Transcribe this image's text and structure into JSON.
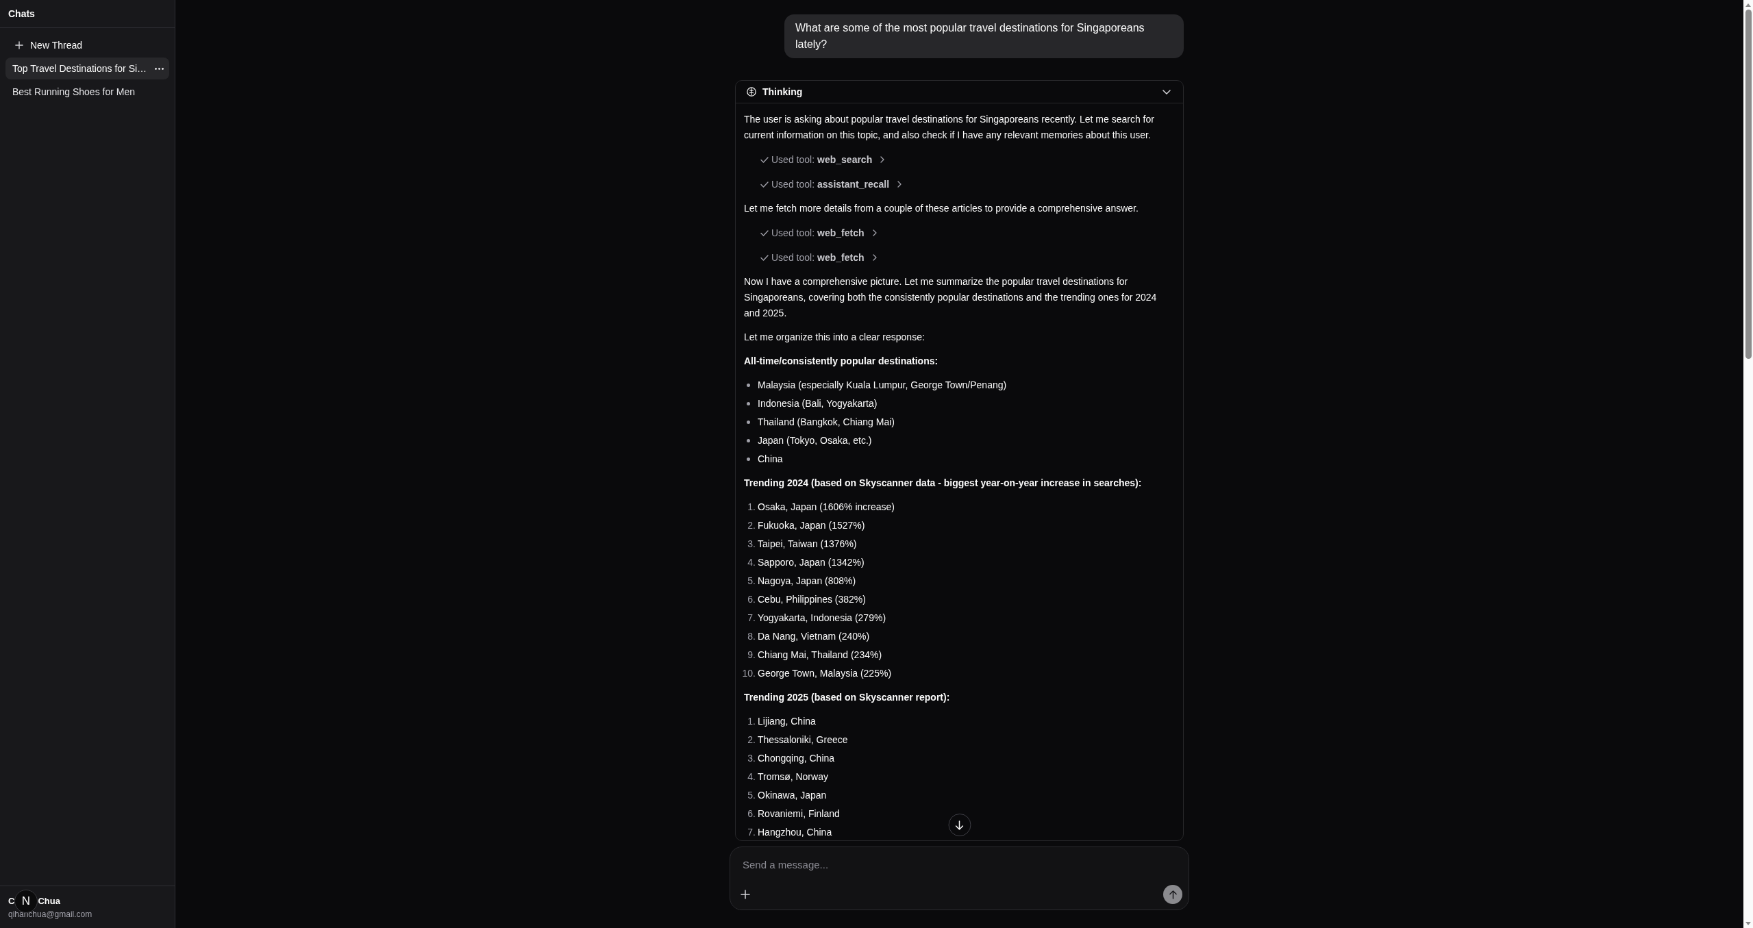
{
  "sidebar": {
    "title": "Chats",
    "new_thread": "New Thread",
    "threads": [
      {
        "title": "Top Travel Destinations for Si…",
        "selected": true
      },
      {
        "title": "Best Running Shoes for Men",
        "selected": false
      }
    ],
    "user": {
      "name_parts": [
        "C",
        "Chua"
      ],
      "email": "qihanchua@gmail.com"
    }
  },
  "floating_badge": {
    "letter": "N"
  },
  "conversation": {
    "user_message": "What are some of the most popular travel destinations for Singaporeans lately?",
    "thinking": {
      "title": "Thinking",
      "expanded": true,
      "blocks": [
        {
          "kind": "paragraph",
          "text": "The user is asking about popular travel destinations for Singaporeans recently. Let me search for current information on this topic, and also check if I have any relevant memories about this user."
        },
        {
          "kind": "tool",
          "label": "Used tool:",
          "name": "web_search",
          "done": true
        },
        {
          "kind": "tool",
          "label": "Used tool:",
          "name": "assistant_recall",
          "done": true
        },
        {
          "kind": "paragraph",
          "text": "Let me fetch more details from a couple of these articles to provide a comprehensive answer."
        },
        {
          "kind": "tool",
          "label": "Used tool:",
          "name": "web_fetch",
          "done": true
        },
        {
          "kind": "tool",
          "label": "Used tool:",
          "name": "web_fetch",
          "done": true
        },
        {
          "kind": "paragraph",
          "text": "Now I have a comprehensive picture. Let me summarize the popular travel destinations for Singaporeans, covering both the consistently popular destinations and the trending ones for 2024 and 2025."
        },
        {
          "kind": "paragraph",
          "text": "Let me organize this into a clear response:"
        },
        {
          "kind": "heading",
          "text": "All-time/consistently popular destinations:"
        },
        {
          "kind": "bullets",
          "items": [
            "Malaysia (especially Kuala Lumpur, George Town/Penang)",
            "Indonesia (Bali, Yogyakarta)",
            "Thailand (Bangkok, Chiang Mai)",
            "Japan (Tokyo, Osaka, etc.)",
            "China"
          ]
        },
        {
          "kind": "heading",
          "text": "Trending 2024 (based on Skyscanner data - biggest year-on-year increase in searches):"
        },
        {
          "kind": "numbered",
          "items": [
            {
              "number": "1.",
              "text": "Osaka, Japan (1606% increase)"
            },
            {
              "number": "2.",
              "text": "Fukuoka, Japan (1527%)"
            },
            {
              "number": "3.",
              "text": "Taipei, Taiwan (1376%)"
            },
            {
              "number": "4.",
              "text": "Sapporo, Japan (1342%)"
            },
            {
              "number": "5.",
              "text": "Nagoya, Japan (808%)"
            },
            {
              "number": "6.",
              "text": "Cebu, Philippines (382%)"
            },
            {
              "number": "7.",
              "text": "Yogyakarta, Indonesia (279%)"
            },
            {
              "number": "8.",
              "text": "Da Nang, Vietnam (240%)"
            },
            {
              "number": "9.",
              "text": "Chiang Mai, Thailand (234%)"
            },
            {
              "number": "10.",
              "text": "George Town, Malaysia (225%)"
            }
          ]
        },
        {
          "kind": "heading",
          "text": "Trending 2025 (based on Skyscanner report):"
        },
        {
          "kind": "numbered",
          "items": [
            {
              "number": "1.",
              "text": "Lijiang, China"
            },
            {
              "number": "2.",
              "text": "Thessaloniki, Greece"
            },
            {
              "number": "3.",
              "text": "Chongqing, China"
            },
            {
              "number": "4.",
              "text": "Tromsø, Norway"
            },
            {
              "number": "5.",
              "text": "Okinawa, Japan"
            },
            {
              "number": "6.",
              "text": "Rovaniemi, Finland"
            },
            {
              "number": "7.",
              "text": "Hangzhou, China"
            }
          ]
        }
      ]
    }
  },
  "composer": {
    "placeholder": "Send a message..."
  }
}
